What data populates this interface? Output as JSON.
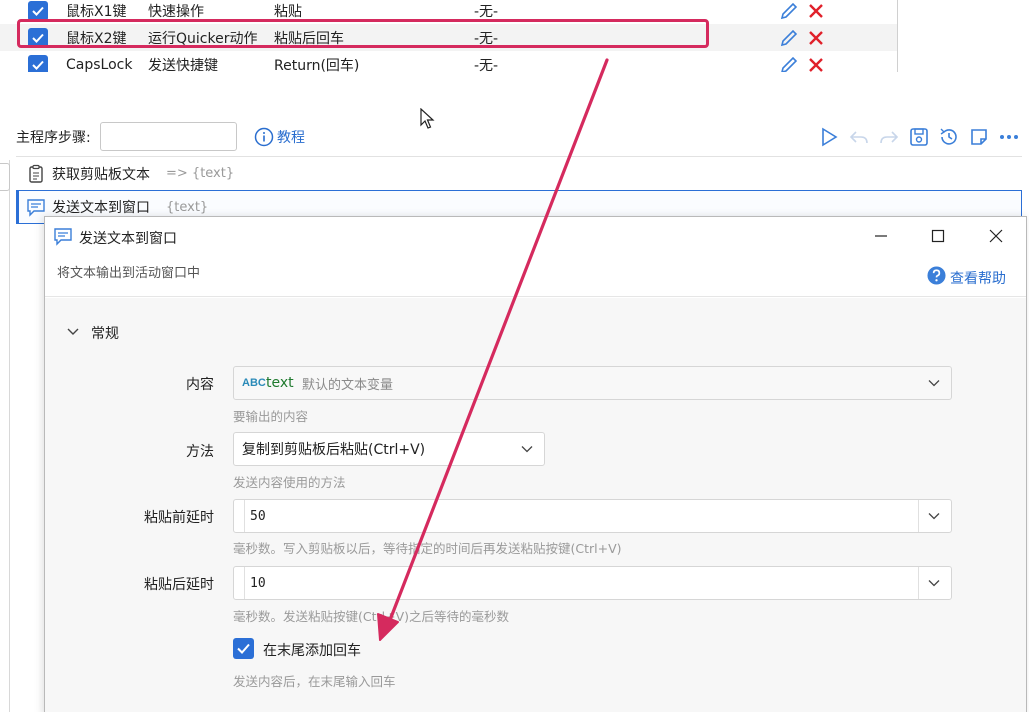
{
  "hotkey_table": {
    "rows": [
      {
        "key": "鼠标X1键",
        "type": "快速操作",
        "action": "粘贴",
        "condition": "-无-"
      },
      {
        "key": "鼠标X2键",
        "type": "运行Quicker动作",
        "action": "粘贴后回车",
        "condition": "-无-"
      },
      {
        "key": "CapsLock",
        "type": "发送快捷键",
        "action": "Return(回车)",
        "condition": "-无-"
      }
    ]
  },
  "editor": {
    "step_label": "主程序步骤:",
    "step_input_value": "",
    "tutorial_label": "教程",
    "steps": [
      {
        "title": "获取剪贴板文本",
        "output": "=> {text}"
      },
      {
        "title": "发送文本到窗口",
        "output": "{text}"
      }
    ]
  },
  "dialog": {
    "title": "发送文本到窗口",
    "description": "将文本输出到活动窗口中",
    "help_label": "查看帮助",
    "section_title": "常规",
    "fields": {
      "content": {
        "label": "内容",
        "var_type": "ABC",
        "var_name": "text",
        "var_desc": "默认的文本变量",
        "hint": "要输出的内容"
      },
      "method": {
        "label": "方法",
        "value": "复制到剪贴板后粘贴(Ctrl+V)",
        "hint": "发送内容使用的方法"
      },
      "pre_delay": {
        "label": "粘贴前延时",
        "value": "50",
        "hint": "毫秒数。写入剪贴板以后，等待指定的时间后再发送粘贴按键(Ctrl+V)"
      },
      "post_delay": {
        "label": "粘贴后延时",
        "value": "10",
        "hint": "毫秒数。发送粘贴按键(Ctrl+V)之后等待的毫秒数"
      },
      "append_enter": {
        "label": "在末尾添加回车",
        "checked": true,
        "hint": "发送内容后，在末尾输入回车"
      }
    }
  },
  "colors": {
    "accent_blue": "#2b6fd6",
    "annotation_red": "#d52a5e",
    "delete_red": "#e0202a"
  }
}
